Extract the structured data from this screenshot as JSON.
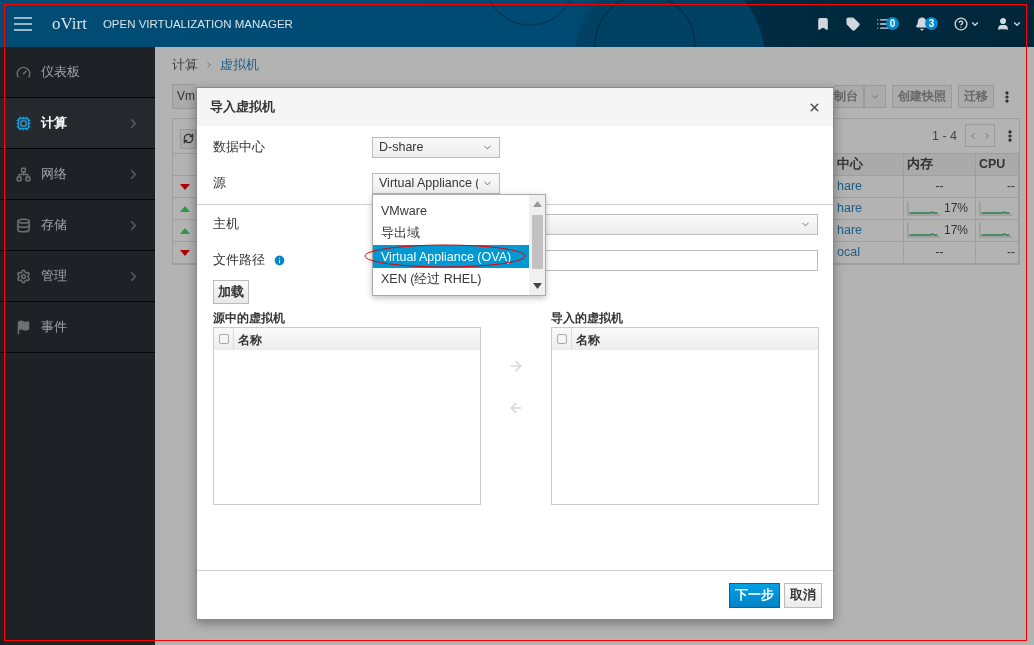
{
  "annotation": {
    "frame": true
  },
  "header": {
    "logo": "oVirt",
    "title": "OPEN VIRTUALIZATION MANAGER",
    "icons": [
      {
        "kind": "bookmark"
      },
      {
        "kind": "tag"
      },
      {
        "kind": "tasks",
        "badge": "0"
      },
      {
        "kind": "bell",
        "badge": "3"
      },
      {
        "kind": "help",
        "menu": true
      },
      {
        "kind": "user",
        "menu": true
      }
    ]
  },
  "sidebar": {
    "items": [
      {
        "kind": "dashboard",
        "label": "仪表板",
        "selected": false,
        "has_children": false
      },
      {
        "kind": "compute",
        "label": "计算",
        "selected": true,
        "has_children": true
      },
      {
        "kind": "network",
        "label": "网络",
        "selected": false,
        "has_children": true
      },
      {
        "kind": "storage",
        "label": "存储",
        "selected": false,
        "has_children": true
      },
      {
        "kind": "admin",
        "label": "管理",
        "selected": false,
        "has_children": true
      },
      {
        "kind": "events",
        "label": "事件",
        "selected": false,
        "has_children": false
      }
    ]
  },
  "page": {
    "breadcrumb": [
      "计算",
      "虚拟机"
    ],
    "search_value": "Vm",
    "actions": [
      "制台",
      "创建快照",
      "迁移"
    ],
    "pagination": "1 - 4",
    "table": {
      "columns": [
        "中心",
        "内存",
        "CPU"
      ],
      "rows": [
        {
          "up": false,
          "datacenter": "hare",
          "memory": {
            "kind": "text",
            "text": "--"
          },
          "cpu": {
            "kind": "text",
            "text": "--"
          }
        },
        {
          "up": true,
          "datacenter": "hare",
          "memory": {
            "kind": "usage",
            "text": "17%"
          },
          "cpu": {
            "kind": "usage"
          }
        },
        {
          "up": true,
          "datacenter": "hare",
          "memory": {
            "kind": "usage",
            "text": "17%"
          },
          "cpu": {
            "kind": "usage"
          }
        },
        {
          "up": false,
          "datacenter": "ocal",
          "memory": {
            "kind": "text",
            "text": "--"
          },
          "cpu": {
            "kind": "text",
            "text": "--"
          }
        }
      ]
    }
  },
  "dialog": {
    "title": "导入虚拟机",
    "fields": [
      {
        "kind": "select",
        "label": "数据中心",
        "value": "D-share",
        "wide": false
      },
      {
        "kind": "select",
        "label": "源",
        "value": "Virtual Appliance (",
        "wide": false
      },
      {
        "kind": "divider"
      },
      {
        "kind": "select",
        "label": "主机",
        "wide": true
      },
      {
        "kind": "input",
        "label": "文件路径",
        "info": true,
        "wide": true
      }
    ],
    "dropdown": {
      "options": [
        {
          "label": "VMware",
          "selected": false,
          "circled": false
        },
        {
          "label": "导出域",
          "selected": false,
          "circled": false
        },
        {
          "label": "Virtual Appliance (OVA)",
          "selected": true,
          "circled": true
        },
        {
          "label": "XEN (经过 RHEL)",
          "selected": false,
          "circled": false
        }
      ]
    },
    "load_button": "加载",
    "lists": [
      {
        "title": "源中的虚拟机",
        "column": "名称",
        "checked": false
      },
      {
        "title": "导入的虚拟机",
        "column": "名称",
        "checked": false
      }
    ],
    "buttons": [
      {
        "label": "下一步",
        "primary": true
      },
      {
        "label": "取消",
        "primary": false
      }
    ]
  }
}
